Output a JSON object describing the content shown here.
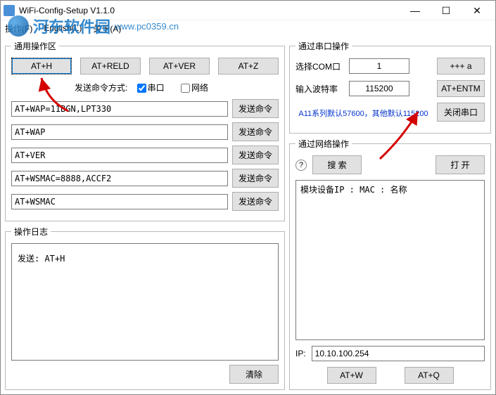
{
  "window": {
    "title": "WiFi-Config-Setup V1.1.0",
    "minimize": "—",
    "maximize": "☐",
    "close": "✕"
  },
  "menu": {
    "operation": "操作(F)",
    "english": "English(L)",
    "about": "关于(A)"
  },
  "watermark": {
    "text": "河东软件园",
    "url": "www.pc0359.cn"
  },
  "general": {
    "legend": "通用操作区",
    "btns": {
      "ath": "AT+H",
      "reld": "AT+RELD",
      "ver": "AT+VER",
      "z": "AT+Z"
    },
    "send_mode_label": "发送命令方式:",
    "chk_serial": "串口",
    "chk_net": "网络",
    "serial_checked": true,
    "net_checked": false,
    "send_btn": "发送命令",
    "cmds": {
      "0": "AT+WAP=11BGN,LPT330",
      "1": "AT+WAP",
      "2": "AT+VER",
      "3": "AT+WSMAC=8888,ACCF2",
      "4": "AT+WSMAC"
    }
  },
  "log": {
    "legend": "操作日志",
    "text": "发送: AT+H",
    "clear": "清除"
  },
  "serial": {
    "legend": "通过串口操作",
    "com_label": "选择COM口",
    "com_value": "1",
    "plus_a": "+++ a",
    "baud_label": "输入波特率",
    "baud_value": "115200",
    "entm": "AT+ENTM",
    "note": "A11系列默认57600，其他默认115200",
    "close": "关闭串口"
  },
  "net": {
    "legend": "通过网络操作",
    "q": "(?)",
    "search": "搜 索",
    "open": "打 开",
    "header": "模块设备IP     :     MAC     :     名称",
    "ip_label": "IP:",
    "ip_value": "10.10.100.254",
    "atw": "AT+W",
    "atq": "AT+Q"
  }
}
